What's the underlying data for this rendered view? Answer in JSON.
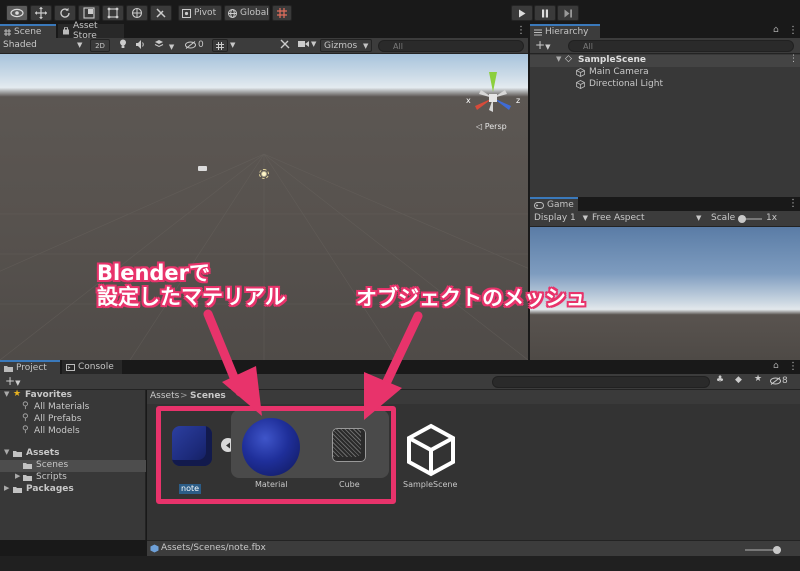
{
  "toolbar": {
    "pivot_label": "Pivot",
    "global_label": "Global",
    "play_icon": "play-icon",
    "pause_icon": "pause-icon",
    "step_icon": "step-icon"
  },
  "scene": {
    "tabs": [
      "Scene",
      "Asset Store"
    ],
    "shading_mode": "Shaded",
    "mode_2d": "2D",
    "hidden_count": "0",
    "gizmos_label": "Gizmos",
    "search_placeholder": "All",
    "persp_label": "Persp",
    "axis_x": "x",
    "axis_z": "z"
  },
  "hierarchy": {
    "tab_label": "Hierarchy",
    "search_placeholder": "All",
    "scene_name": "SampleScene",
    "items": [
      "Main Camera",
      "Directional Light"
    ]
  },
  "game": {
    "tab_label": "Game",
    "display_label": "Display 1",
    "aspect_label": "Free Aspect",
    "scale_label": "Scale",
    "scale_value": "1x"
  },
  "project": {
    "tabs": [
      "Project",
      "Console"
    ],
    "badge_count": "8",
    "favorites_label": "Favorites",
    "favorites": [
      "All Materials",
      "All Prefabs",
      "All Models"
    ],
    "assets_label": "Assets",
    "asset_folders": [
      "Scenes",
      "Scripts"
    ],
    "packages_label": "Packages",
    "breadcrumb": [
      "Assets",
      "Scenes"
    ],
    "breadcrumb_sep": ">",
    "items": [
      {
        "name": "note",
        "kind": "fbx-model"
      },
      {
        "name": "Material",
        "kind": "material"
      },
      {
        "name": "Cube",
        "kind": "mesh"
      },
      {
        "name": "SampleScene",
        "kind": "scene"
      }
    ],
    "status_path": "Assets/Scenes/note.fbx"
  },
  "annotations": {
    "left_line1": "Blenderで",
    "left_line2": "設定したマテリアル",
    "right_line1": "オブジェクトのメッシュ",
    "accent_color": "#e8336b"
  },
  "colors": {
    "selection": "#2c5d87",
    "tab_accent": "#3a79bb"
  }
}
